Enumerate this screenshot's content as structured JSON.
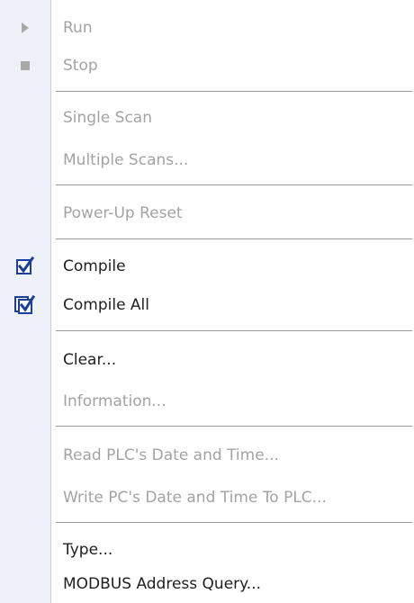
{
  "menu": {
    "run": "Run",
    "stop": "Stop",
    "single_scan": "Single Scan",
    "multiple_scans": "Multiple Scans...",
    "power_up_reset": "Power-Up Reset",
    "compile": "Compile",
    "compile_all": "Compile All",
    "clear": "Clear...",
    "information": "Information...",
    "read_plc_date_time": "Read PLC's Date and Time...",
    "write_pc_date_time": "Write PC's Date and Time To PLC...",
    "type": "Type...",
    "modbus_address_query": "MODBUS Address Query..."
  },
  "icons": {
    "run": "play-icon",
    "stop": "stop-icon",
    "compile": "compile-check-icon",
    "compile_all": "compile-all-check-icon"
  },
  "colors": {
    "gutter": "#eef2f8",
    "disabled_text": "#a3a3a3",
    "enabled_text": "#202020",
    "check_blue": "#1a3f9a"
  }
}
